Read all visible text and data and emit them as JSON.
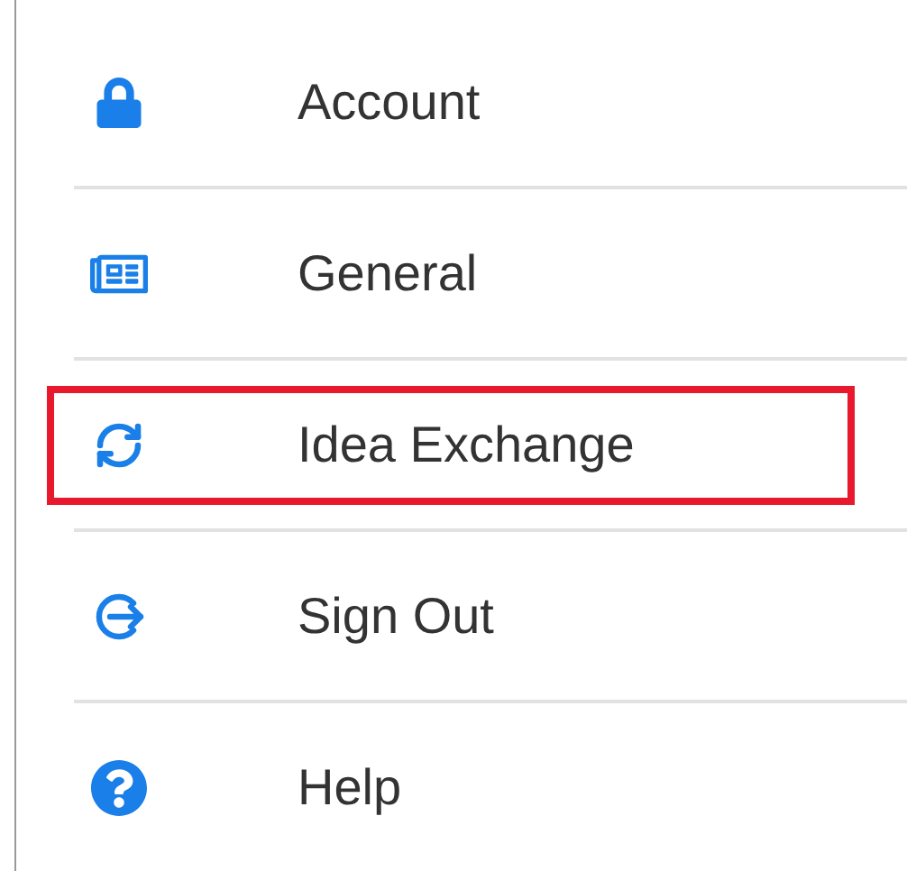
{
  "menu": {
    "items": [
      {
        "kind": "lock",
        "label": "Account",
        "highlighted": false
      },
      {
        "kind": "newspaper",
        "label": "General",
        "highlighted": false
      },
      {
        "kind": "sync",
        "label": "Idea Exchange",
        "highlighted": true
      },
      {
        "kind": "signout",
        "label": "Sign Out",
        "highlighted": false
      },
      {
        "kind": "help",
        "label": "Help",
        "highlighted": false
      }
    ]
  }
}
